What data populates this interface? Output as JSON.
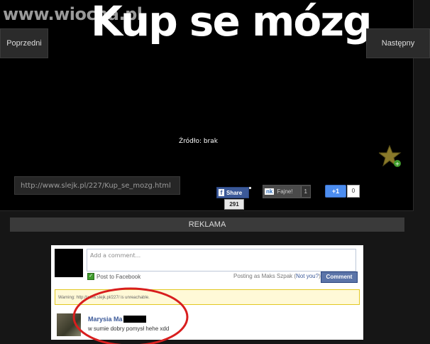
{
  "watermark": "www.wiocha.pl",
  "meme": {
    "title": "Kup se mózg"
  },
  "nav": {
    "prev": "Poprzedni",
    "next": "Następny"
  },
  "source": {
    "label": "Źródło: brak"
  },
  "share": {
    "url": "http://www.slejk.pl/227/Kup_se_mozg.html",
    "facebook_label": "Share",
    "facebook_count": "291",
    "nk_logo": "nk",
    "nk_label": "Fajne!",
    "nk_count": "1",
    "gplus_label": "+1",
    "gplus_count": "0"
  },
  "ad": {
    "label": "REKLAMA"
  },
  "comments": {
    "placeholder": "Add a comment...",
    "post_to_facebook": "Post to Facebook",
    "posting_as_prefix": "Posting as Maks Szpak (",
    "not_you": "Not you?",
    "posting_as_suffix": ")",
    "comment_button": "Comment",
    "warning": "Warning: http://www.slejk.pl/227/ is unreachable.",
    "items": [
      {
        "author": "Marysia Ma",
        "text": "w sumie dobry pomysł hehe xdd"
      }
    ]
  },
  "colors": {
    "accent_red": "#d81e1e",
    "facebook_blue": "#3b5998"
  }
}
